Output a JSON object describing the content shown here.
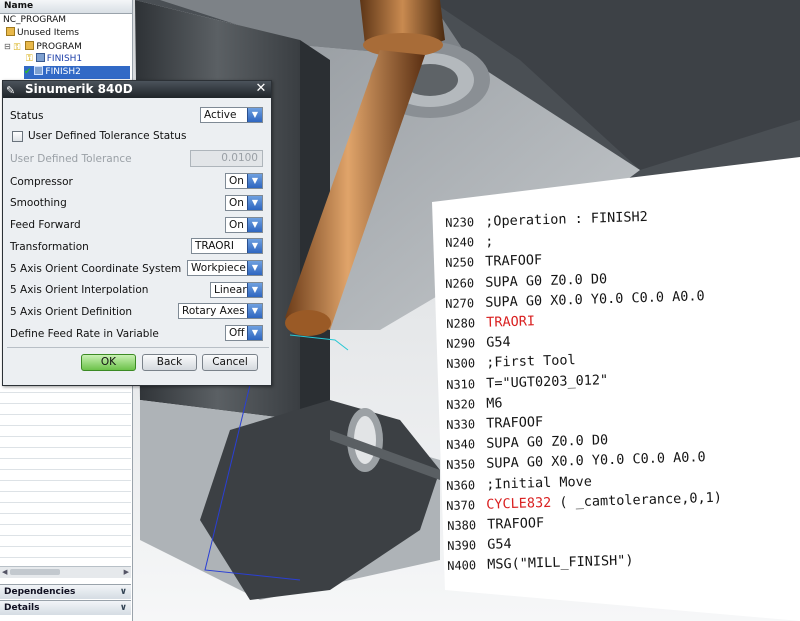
{
  "navigator": {
    "header": "Name",
    "tree": [
      {
        "label": "NC_PROGRAM"
      },
      {
        "label": "Unused Items"
      },
      {
        "label": "PROGRAM"
      },
      {
        "label": "FINISH1"
      },
      {
        "label": "FINISH2",
        "selected": true
      }
    ],
    "accordions": {
      "dependencies": "Dependencies",
      "details": "Details"
    }
  },
  "dialog": {
    "title": "Sinumerik 840D",
    "rows": [
      {
        "label": "Status",
        "value": "Active"
      },
      {
        "label": "User Defined Tolerance Status",
        "checked": false
      },
      {
        "label": "User Defined Tolerance",
        "value": "0.0100",
        "disabled": true
      },
      {
        "label": "Compressor",
        "value": "On"
      },
      {
        "label": "Smoothing",
        "value": "On"
      },
      {
        "label": "Feed Forward",
        "value": "On"
      },
      {
        "label": "Transformation",
        "value": "TRAORI"
      },
      {
        "label": "5 Axis Orient Coordinate System",
        "value": "Workpiece"
      },
      {
        "label": "5 Axis Orient Interpolation",
        "value": "Linear"
      },
      {
        "label": "5 Axis Orient Definition",
        "value": "Rotary Axes"
      },
      {
        "label": "Define Feed Rate in Variable",
        "value": "Off"
      }
    ],
    "buttons": {
      "ok": "OK",
      "back": "Back",
      "cancel": "Cancel"
    }
  },
  "code_listing": [
    {
      "n": "N230",
      "text": ";Operation : FINISH2"
    },
    {
      "n": "N240",
      "text": ";"
    },
    {
      "n": "N250",
      "text": "TRAFOOF"
    },
    {
      "n": "N260",
      "text": "SUPA G0 Z0.0 D0"
    },
    {
      "n": "N270",
      "text": "SUPA G0 X0.0 Y0.0 C0.0 A0.0"
    },
    {
      "n": "N280",
      "text": "TRAORI",
      "highlight": true
    },
    {
      "n": "N290",
      "text": "G54"
    },
    {
      "n": "N300",
      "text": ";First Tool"
    },
    {
      "n": "N310",
      "text": "T=\"UGT0203_012\""
    },
    {
      "n": "N320",
      "text": "M6"
    },
    {
      "n": "N330",
      "text": "TRAFOOF"
    },
    {
      "n": "N340",
      "text": "SUPA G0 Z0.0 D0"
    },
    {
      "n": "N350",
      "text": "SUPA G0 X0.0 Y0.0 C0.0 A0.0"
    },
    {
      "n": "N360",
      "text": ";Initial Move"
    },
    {
      "n": "N370",
      "text": "CYCLE832",
      "highlight": true,
      "rest": " ( _camtolerance,0,1)"
    },
    {
      "n": "N380",
      "text": "TRAFOOF"
    },
    {
      "n": "N390",
      "text": "G54"
    },
    {
      "n": "N400",
      "text": "MSG(\"MILL_FINISH\")"
    }
  ],
  "colors": {
    "highlight_code": "#d92020",
    "tool_copper": "#b9723a",
    "part_gray": "#6b7075",
    "ok_button": "#6cc24a"
  }
}
